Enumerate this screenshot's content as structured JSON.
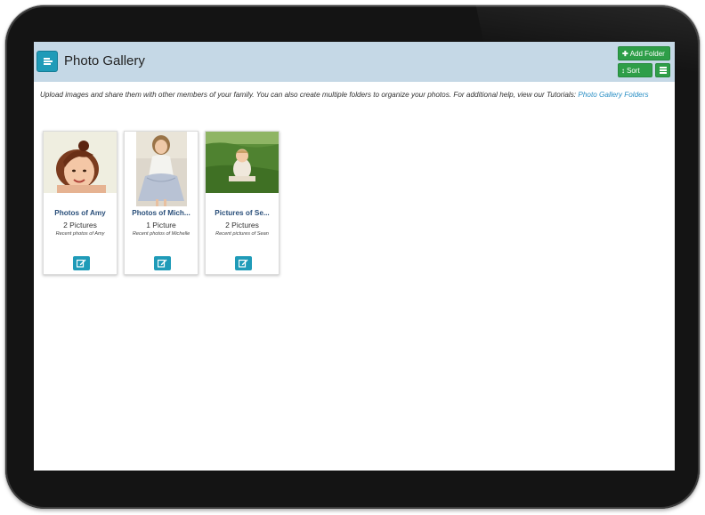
{
  "header": {
    "title": "Photo Gallery",
    "menu_icon": "menu-list-icon",
    "add_folder_label": "Add Folder",
    "add_folder_icon": "plus-icon",
    "sort_label": "Sort",
    "sort_icon": "sort-icon",
    "list_view_icon": "list-view-icon"
  },
  "intro": {
    "text": "Upload images and share them with other members of your family. You can also create multiple folders to organize your photos. For additional help, view our Tutorials:",
    "link_label": "Photo Gallery Folders"
  },
  "folders": [
    {
      "title": "Photos of Amy",
      "count": "2 Pictures",
      "description": "Recent photos of Amy",
      "edit_icon": "edit-icon"
    },
    {
      "title": "Photos of Mich...",
      "count": "1 Picture",
      "description": "Recent photos of Michelle",
      "edit_icon": "edit-icon"
    },
    {
      "title": "Pictures of Se...",
      "count": "2 Pictures",
      "description": "Recent pictures of Sean",
      "edit_icon": "edit-icon"
    }
  ],
  "colors": {
    "header_bg": "#c5d8e6",
    "accent_teal": "#1f9bb8",
    "button_green": "#2e9e48",
    "folder_title": "#2a4f7a",
    "link": "#2a8fc5",
    "tablet_frame": "#141414"
  }
}
